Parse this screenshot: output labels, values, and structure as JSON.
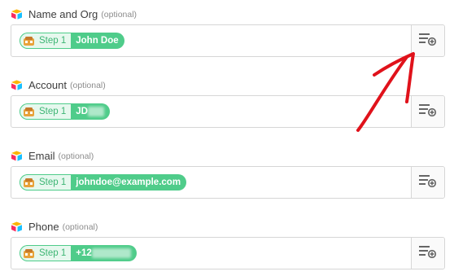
{
  "fields": [
    {
      "id": "name-org",
      "title": "Name and Org",
      "optional": "(optional)",
      "step": "Step 1",
      "value": "John Doe",
      "redacted": false
    },
    {
      "id": "account",
      "title": "Account",
      "optional": "(optional)",
      "step": "Step 1",
      "value": "JD",
      "redacted": true
    },
    {
      "id": "email",
      "title": "Email",
      "optional": "(optional)",
      "step": "Step 1",
      "value": "johndoe@example.com",
      "redacted": false
    },
    {
      "id": "phone",
      "title": "Phone",
      "optional": "(optional)",
      "step": "Step 1",
      "value": "+12",
      "redacted": true
    }
  ],
  "colors": {
    "pill": "#4fcc8a",
    "annotation_arrow": "#e0121b"
  },
  "icons": {
    "field_icon": "airtable-logo-icon",
    "step_app_icon": "app-logo-icon",
    "insert_button_icon": "insert-data-icon"
  }
}
